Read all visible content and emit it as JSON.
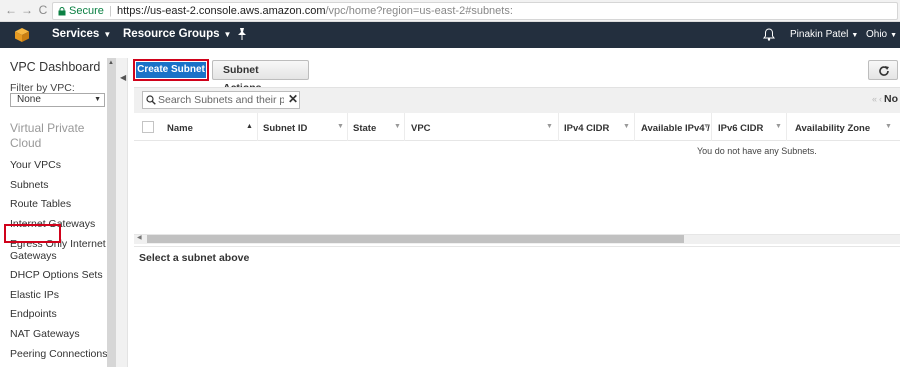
{
  "browser": {
    "secure_label": "Secure",
    "url_host": "https://us-east-2.console.aws.amazon.com",
    "url_path": "/vpc/home?region=us-east-2#subnets:"
  },
  "topnav": {
    "services": "Services",
    "resource_groups": "Resource Groups",
    "user": "Pinakin Patel",
    "region": "Ohio"
  },
  "sidebar": {
    "title": "VPC Dashboard",
    "filter_label": "Filter by VPC:",
    "filter_value": "None",
    "section_title": "Virtual Private Cloud",
    "items": [
      "Your VPCs",
      "Subnets",
      "Route Tables",
      "Internet Gateways",
      "Egress Only Internet Gateways",
      "DHCP Options Sets",
      "Elastic IPs",
      "Endpoints",
      "NAT Gateways",
      "Peering Connections"
    ]
  },
  "toolbar": {
    "create_label": "Create Subnet",
    "actions_label": "Subnet Actions"
  },
  "search": {
    "placeholder": "Search Subnets and their properties",
    "pager_text": "No"
  },
  "table": {
    "columns": [
      "Name",
      "Subnet ID",
      "State",
      "VPC",
      "IPv4 CIDR",
      "Available IPv4 /",
      "IPv6 CIDR",
      "Availability Zone"
    ],
    "empty_message": "You do not have any Subnets."
  },
  "detail": {
    "message": "Select a subnet above"
  },
  "colors": {
    "nav_bg": "#232f3e",
    "primary_button": "#1a72c8",
    "highlight_box": "#d0021b",
    "secure_green": "#0b8043"
  }
}
